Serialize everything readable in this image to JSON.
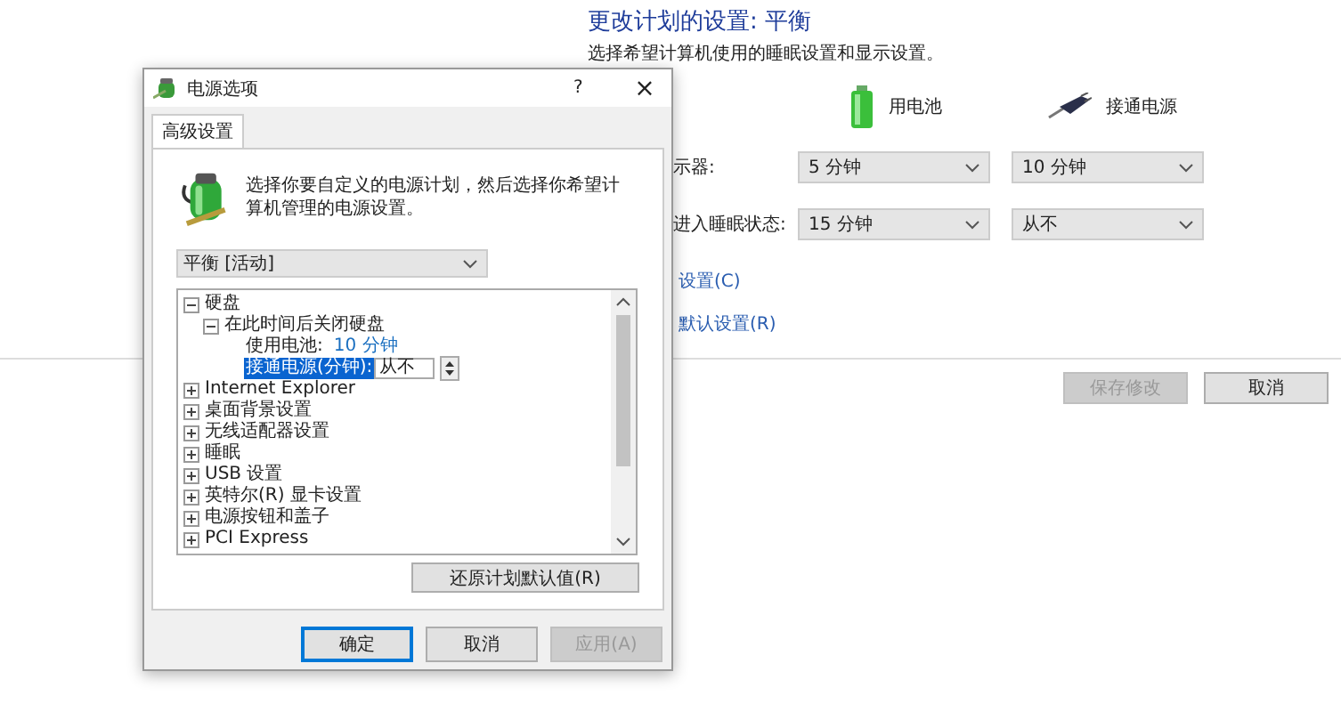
{
  "page": {
    "title": "更改计划的设置: 平衡",
    "description": "选择希望计算机使用的睡眠设置和显示设置。",
    "columns": [
      {
        "kind": "battery",
        "label": "用电池"
      },
      {
        "kind": "plug",
        "label": "接通电源"
      }
    ],
    "rows": [
      {
        "label": "示器:",
        "values": [
          "5 分钟",
          "10 分钟"
        ]
      },
      {
        "label": "进入睡眠状态:",
        "values": [
          "15 分钟",
          "从不"
        ]
      }
    ],
    "links": [
      "设置(C)",
      "默认设置(R)"
    ],
    "buttons": [
      {
        "label": "保存修改",
        "disabled": true
      },
      {
        "label": "取消",
        "disabled": false
      }
    ]
  },
  "dialog": {
    "title": "电源选项",
    "help": "?",
    "close": "×",
    "tabs": [
      {
        "label": "高级设置",
        "selected": true
      }
    ],
    "intro": "选择你要自定义的电源计划，然后选择你希望计算机管理的电源设置。",
    "plan": "平衡 [活动]",
    "tree": [
      {
        "kind": "group",
        "label": "硬盘",
        "expanded": true,
        "children": [
          {
            "kind": "group",
            "label": "在此时间后关闭硬盘",
            "expanded": true,
            "children": [
              {
                "kind": "value",
                "label": "使用电池:",
                "value": "10 分钟",
                "selected": false
              },
              {
                "kind": "edit",
                "label": "接通电源(分钟):",
                "value": "从不",
                "selected": true
              }
            ]
          }
        ]
      },
      {
        "kind": "group",
        "label": "Internet Explorer",
        "expanded": false
      },
      {
        "kind": "group",
        "label": "桌面背景设置",
        "expanded": false
      },
      {
        "kind": "group",
        "label": "无线适配器设置",
        "expanded": false
      },
      {
        "kind": "group",
        "label": "睡眠",
        "expanded": false
      },
      {
        "kind": "group",
        "label": "USB 设置",
        "expanded": false
      },
      {
        "kind": "group",
        "label": "英特尔(R) 显卡设置",
        "expanded": false
      },
      {
        "kind": "group",
        "label": "电源按钮和盖子",
        "expanded": false
      },
      {
        "kind": "group",
        "label": "PCI Express",
        "expanded": false
      }
    ],
    "restore": "还原计划默认值(R)",
    "buttons": [
      {
        "label": "确定",
        "default": true,
        "disabled": false
      },
      {
        "label": "取消",
        "default": false,
        "disabled": false
      },
      {
        "label": "应用(A)",
        "default": false,
        "disabled": true
      }
    ]
  }
}
